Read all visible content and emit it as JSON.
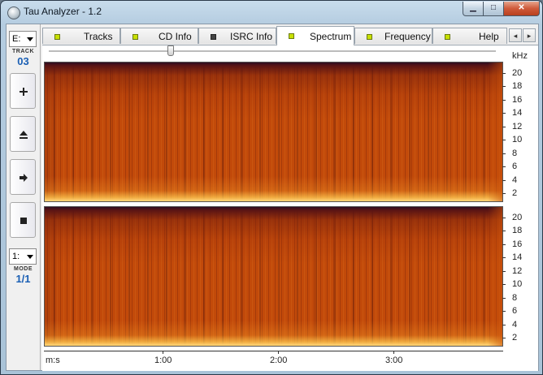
{
  "window": {
    "title": "Tau Analyzer - 1.2",
    "controls": {
      "minimize": "▁",
      "maximize": "□",
      "close": "✕"
    }
  },
  "left_panel": {
    "drive_combo": "E:",
    "track_label": "TRACK",
    "track_value": "03",
    "buttons": [
      {
        "name": "add-button",
        "icon": "plus-icon"
      },
      {
        "name": "eject-button",
        "icon": "eject-icon"
      },
      {
        "name": "play-button",
        "icon": "arrow-right-icon"
      },
      {
        "name": "stop-button",
        "icon": "stop-icon"
      }
    ],
    "mode_combo": "1:",
    "mode_label": "MODE",
    "mode_value": "1/1"
  },
  "tabs": [
    {
      "label": "Tracks",
      "indicator": "green",
      "active": false
    },
    {
      "label": "CD Info",
      "indicator": "green",
      "active": false
    },
    {
      "label": "ISRC Info",
      "indicator": "dark",
      "active": false
    },
    {
      "label": "Spectrum",
      "indicator": "green",
      "active": true
    },
    {
      "label": "Frequency",
      "indicator": "green",
      "active": false
    },
    {
      "label": "Help",
      "indicator": "green",
      "active": false
    }
  ],
  "tab_nav": {
    "prev": "◂",
    "next": "▸"
  },
  "spectrum": {
    "zoom_position": 0.27,
    "y_unit": "kHz",
    "y_ticks": [
      "20",
      "18",
      "16",
      "14",
      "12",
      "10",
      "8",
      "6",
      "4",
      "2"
    ],
    "x_unit": "m:s",
    "x_ticks": [
      "1:00",
      "2:00",
      "3:00"
    ],
    "colors": {
      "low": "#2e0c20",
      "mid": "#c24a0a",
      "high": "#ffd070"
    }
  }
}
